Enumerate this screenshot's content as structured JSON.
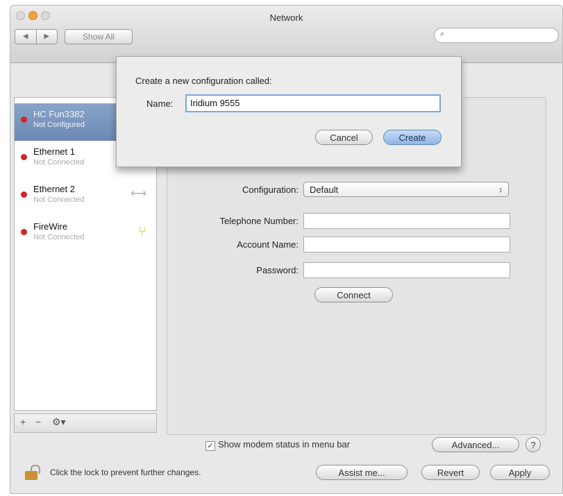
{
  "window": {
    "title": "Network",
    "show_all_label": "Show All",
    "back_glyph": "◀",
    "forward_glyph": "▶",
    "search_placeholder": ""
  },
  "sidebar": {
    "items": [
      {
        "name": "HC Fun3382",
        "status": "Not Configured",
        "icon": "modem-icon"
      },
      {
        "name": "Ethernet 1",
        "status": "Not Connected",
        "icon": "ethernet-icon"
      },
      {
        "name": "Ethernet 2",
        "status": "Not Connected",
        "icon": "ethernet-icon"
      },
      {
        "name": "FireWire",
        "status": "Not Connected",
        "icon": "firewire-icon"
      }
    ],
    "toolbar": {
      "add": "+",
      "remove": "−",
      "action": "⚙▾"
    }
  },
  "form": {
    "configuration_label": "Configuration:",
    "configuration_value": "Default",
    "telephone_label": "Telephone Number:",
    "telephone_value": "",
    "account_label": "Account Name:",
    "account_value": "",
    "password_label": "Password:",
    "password_value": "",
    "connect_label": "Connect"
  },
  "bottom": {
    "show_modem_status_label": "Show modem status in menu bar",
    "show_modem_status_checked": true,
    "advanced_label": "Advanced...",
    "help_label": "?",
    "lock_text": "Click the lock to prevent further changes.",
    "assist_label": "Assist me...",
    "revert_label": "Revert",
    "apply_label": "Apply"
  },
  "sheet": {
    "title": "Create a new configuration called:",
    "name_label": "Name:",
    "name_value": "Iridium 9555",
    "cancel_label": "Cancel",
    "create_label": "Create"
  },
  "colors": {
    "accent": "#7ea6d8",
    "status_dot": "#d2232a",
    "selection": "#6b89b5"
  }
}
